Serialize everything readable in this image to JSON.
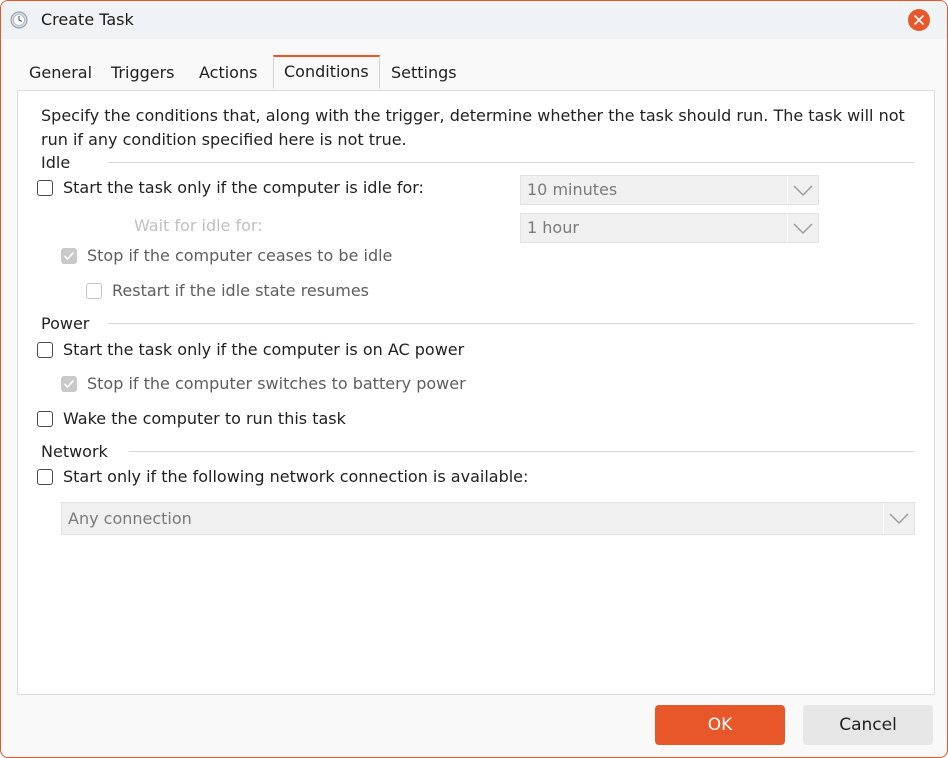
{
  "window": {
    "title": "Create Task"
  },
  "tabs": [
    "General",
    "Triggers",
    "Actions",
    "Conditions",
    "Settings"
  ],
  "active_tab": "Conditions",
  "description": "Specify the conditions that, along with the trigger, determine whether the task should run.  The task will not run  if any condition specified here is not true.",
  "idle": {
    "group_label": "Idle",
    "start_if_idle": {
      "label": "Start the task only if the computer is idle for:",
      "checked": false
    },
    "idle_for_value": "10 minutes",
    "wait_label": "Wait for idle for:",
    "wait_value": "1 hour",
    "stop_if_ceases": {
      "label": "Stop if the computer ceases to be idle",
      "checked": true
    },
    "restart_if_resumes": {
      "label": "Restart if the idle state resumes",
      "checked": false
    }
  },
  "power": {
    "group_label": "Power",
    "ac_power": {
      "label": "Start the task only if the computer is on AC power",
      "checked": false
    },
    "stop_on_battery": {
      "label": "Stop if the computer switches to battery power",
      "checked": true
    },
    "wake": {
      "label": "Wake the computer to run this task",
      "checked": false
    }
  },
  "network": {
    "group_label": "Network",
    "start_if_network": {
      "label": "Start only if the following network connection is available:",
      "checked": false
    },
    "connection_value": "Any connection"
  },
  "buttons": {
    "ok": "OK",
    "cancel": "Cancel"
  },
  "colors": {
    "accent": "#e8572a",
    "disabled_fill": "#f0f0f0"
  },
  "icons": {
    "app": "clock-icon",
    "close": "close-icon",
    "dropdown": "chevron-down-icon",
    "check": "checkmark-icon"
  }
}
